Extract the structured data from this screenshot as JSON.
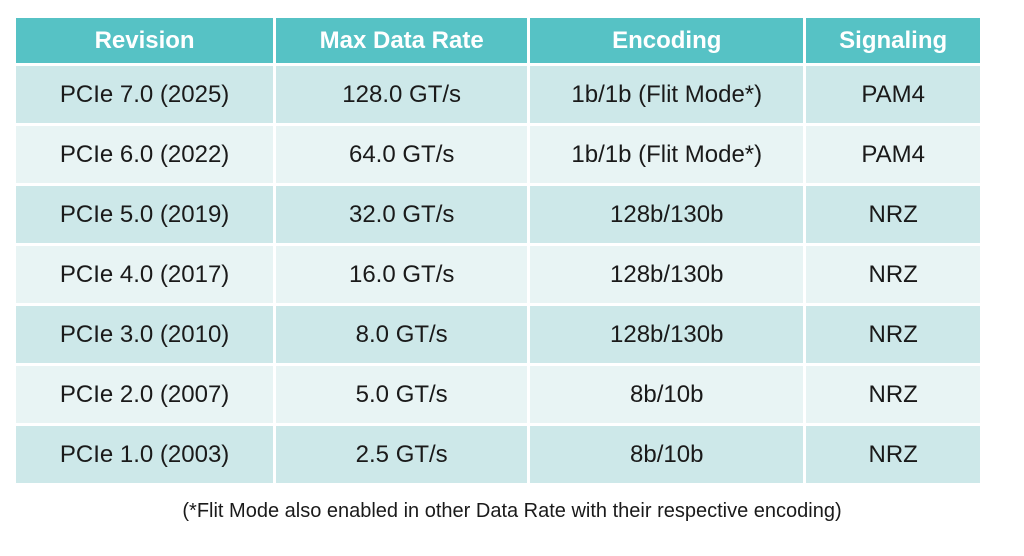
{
  "table": {
    "headers": [
      "Revision",
      "Max Data Rate",
      "Encoding",
      "Signaling"
    ],
    "rows": [
      [
        "PCIe 7.0 (2025)",
        "128.0 GT/s",
        "1b/1b (Flit Mode*)",
        "PAM4"
      ],
      [
        "PCIe 6.0 (2022)",
        "64.0 GT/s",
        "1b/1b (Flit Mode*)",
        "PAM4"
      ],
      [
        "PCIe 5.0 (2019)",
        "32.0 GT/s",
        "128b/130b",
        "NRZ"
      ],
      [
        "PCIe 4.0 (2017)",
        "16.0 GT/s",
        "128b/130b",
        "NRZ"
      ],
      [
        "PCIe 3.0 (2010)",
        "8.0 GT/s",
        "128b/130b",
        "NRZ"
      ],
      [
        "PCIe 2.0 (2007)",
        "5.0 GT/s",
        "8b/10b",
        "NRZ"
      ],
      [
        "PCIe 1.0 (2003)",
        "2.5 GT/s",
        "8b/10b",
        "NRZ"
      ]
    ]
  },
  "footnote": "(*Flit Mode also enabled in other Data Rate with their respective encoding)",
  "colors": {
    "header": "#56c2c5",
    "row_odd": "#cde8e9",
    "row_even": "#e8f4f4"
  }
}
